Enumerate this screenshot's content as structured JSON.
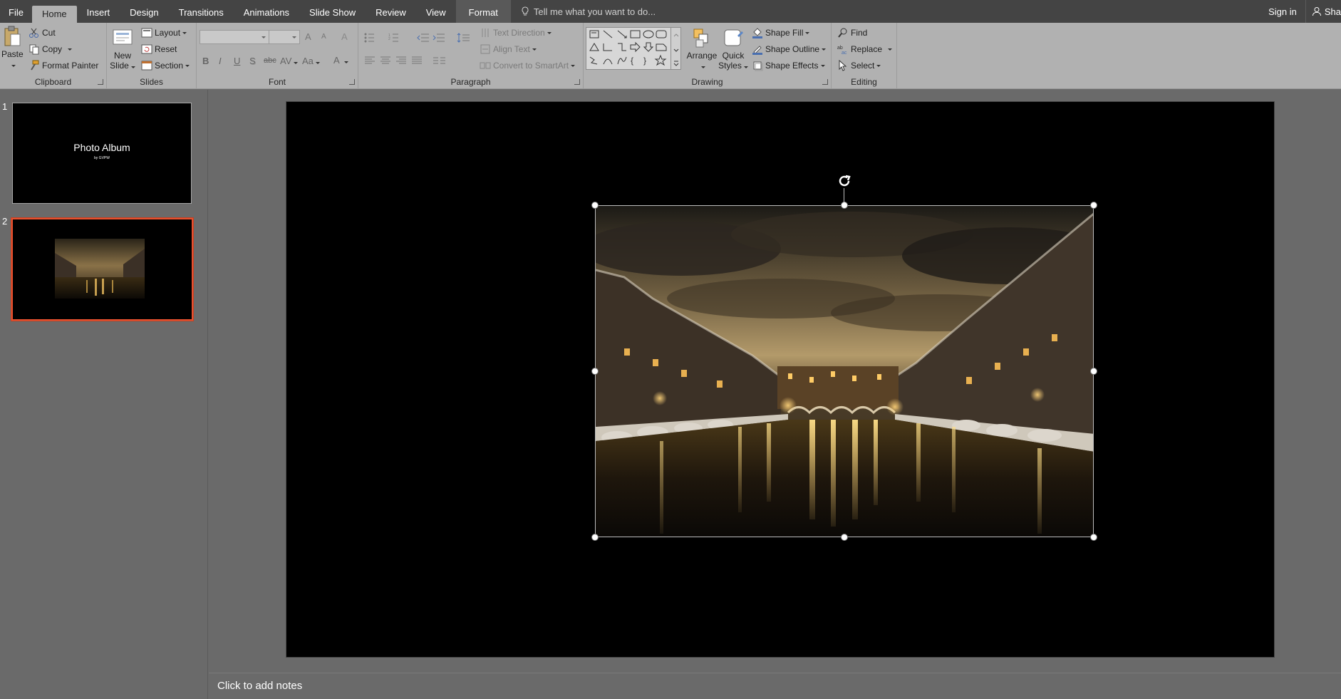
{
  "tabs": [
    {
      "label": "File"
    },
    {
      "label": "Home"
    },
    {
      "label": "Insert"
    },
    {
      "label": "Design"
    },
    {
      "label": "Transitions"
    },
    {
      "label": "Animations"
    },
    {
      "label": "Slide Show"
    },
    {
      "label": "Review"
    },
    {
      "label": "View"
    },
    {
      "label": "Format"
    }
  ],
  "tellme_placeholder": "Tell me what you want to do...",
  "signin": "Sign in",
  "share": "Sha",
  "clipboard": {
    "paste": "Paste",
    "cut": "Cut",
    "copy": "Copy",
    "format_painter": "Format Painter",
    "label": "Clipboard"
  },
  "slides_group": {
    "new_slide_1": "New",
    "new_slide_2": "Slide",
    "layout": "Layout",
    "reset": "Reset",
    "section": "Section",
    "label": "Slides"
  },
  "font_group": {
    "font_name": "",
    "font_size": "",
    "bold": "B",
    "italic": "I",
    "underline": "U",
    "shadow": "S",
    "strike": "abc",
    "spacing": "AV",
    "case": "Aa",
    "color": "A",
    "grow": "A",
    "shrink": "A",
    "label": "Font"
  },
  "paragraph_group": {
    "text_direction": "Text Direction",
    "align_text": "Align Text",
    "convert_smartart": "Convert to SmartArt",
    "label": "Paragraph"
  },
  "drawing_group": {
    "arrange": "Arrange",
    "quick_styles_1": "Quick",
    "quick_styles_2": "Styles",
    "shape_fill": "Shape Fill",
    "shape_outline": "Shape Outline",
    "shape_effects": "Shape Effects",
    "label": "Drawing"
  },
  "editing_group": {
    "find": "Find",
    "replace": "Replace",
    "select": "Select",
    "label": "Editing"
  },
  "slides": [
    {
      "number": "1",
      "title": "Photo Album",
      "subtitle": "by GVPW"
    },
    {
      "number": "2"
    }
  ],
  "notes_placeholder": "Click to add notes",
  "colors": {
    "accent_selection": "#e8512f",
    "ribbon": "#b1b1b1",
    "tabbar": "#444444",
    "workspace": "#6a6a6a"
  }
}
